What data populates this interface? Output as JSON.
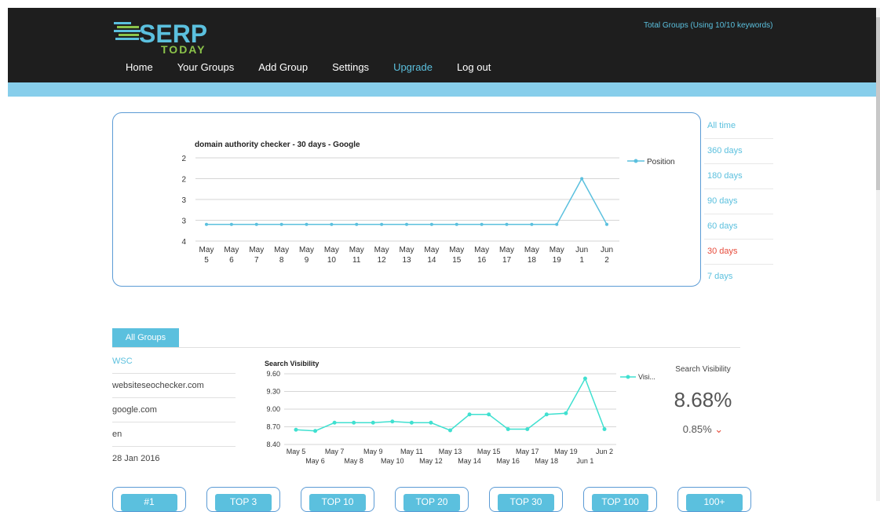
{
  "header": {
    "logo_text": "SERP",
    "logo_sub": "TODAY",
    "total_groups": "Total Groups (Using 10/10 keywords)",
    "nav": [
      {
        "label": "Home"
      },
      {
        "label": "Your Groups"
      },
      {
        "label": "Add Group"
      },
      {
        "label": "Settings"
      },
      {
        "label": "Upgrade"
      },
      {
        "label": "Log out"
      }
    ]
  },
  "position_chart": {
    "title": "domain authority checker - 30 days - Google",
    "legend": "Position",
    "chart_data": {
      "type": "line",
      "title": "domain authority checker - 30 days - Google",
      "y_ticks": [
        "2",
        "2",
        "3",
        "3",
        "4"
      ],
      "categories": [
        "May 5",
        "May 6",
        "May 7",
        "May 8",
        "May 9",
        "May 10",
        "May 11",
        "May 12",
        "May 13",
        "May 14",
        "May 15",
        "May 16",
        "May 17",
        "May 18",
        "May 19",
        "Jun 1",
        "Jun 2"
      ],
      "series": [
        {
          "name": "Position",
          "values": [
            3.3,
            3.3,
            3.3,
            3.3,
            3.3,
            3.3,
            3.3,
            3.3,
            3.3,
            3.3,
            3.3,
            3.3,
            3.3,
            3.3,
            3.3,
            2.2,
            3.3
          ]
        }
      ],
      "ylim": [
        1.7,
        3.7
      ],
      "inverted": true
    }
  },
  "ranges": [
    {
      "label": "All time"
    },
    {
      "label": "360 days"
    },
    {
      "label": "180 days"
    },
    {
      "label": "90 days"
    },
    {
      "label": "60 days"
    },
    {
      "label": "30 days",
      "active": true
    },
    {
      "label": "7 days"
    }
  ],
  "tabs": {
    "all_groups": "All Groups"
  },
  "info": {
    "group": "WSC",
    "domain": "websiteseochecker.com",
    "engine": "google.com",
    "lang": "en",
    "date": "28 Jan 2016"
  },
  "visibility_chart": {
    "title": "Search Visibility",
    "legend": "Visi...",
    "chart_data": {
      "type": "line",
      "title": "Search Visibility",
      "y_ticks": [
        "9.60",
        "9.30",
        "9.00",
        "8.70",
        "8.40"
      ],
      "categories": [
        "May 5",
        "May 6",
        "May 7",
        "May 8",
        "May 9",
        "May 10",
        "May 11",
        "May 12",
        "May 13",
        "May 14",
        "May 15",
        "May 16",
        "May 17",
        "May 18",
        "May 19",
        "Jun 1",
        "Jun 2"
      ],
      "series": [
        {
          "name": "Visi...",
          "values": [
            8.65,
            8.63,
            8.77,
            8.77,
            8.77,
            8.79,
            8.77,
            8.77,
            8.64,
            8.91,
            8.91,
            8.66,
            8.66,
            8.91,
            8.93,
            9.52,
            8.66
          ]
        }
      ],
      "ylim": [
        8.4,
        9.6
      ]
    }
  },
  "vis_panel": {
    "label": "Search Visibility",
    "value": "8.68%",
    "change": "0.85%"
  },
  "position_buttons": [
    "#1",
    "TOP 3",
    "TOP 10",
    "TOP 20",
    "TOP 30",
    "TOP 100",
    "100+"
  ],
  "colors": {
    "accent": "#5bc0de",
    "active_range": "#e74c3c",
    "header_bg": "#1e1e1e",
    "bar": "#87ceeb",
    "line1": "#5bc0de",
    "line2": "#40e0d0"
  }
}
